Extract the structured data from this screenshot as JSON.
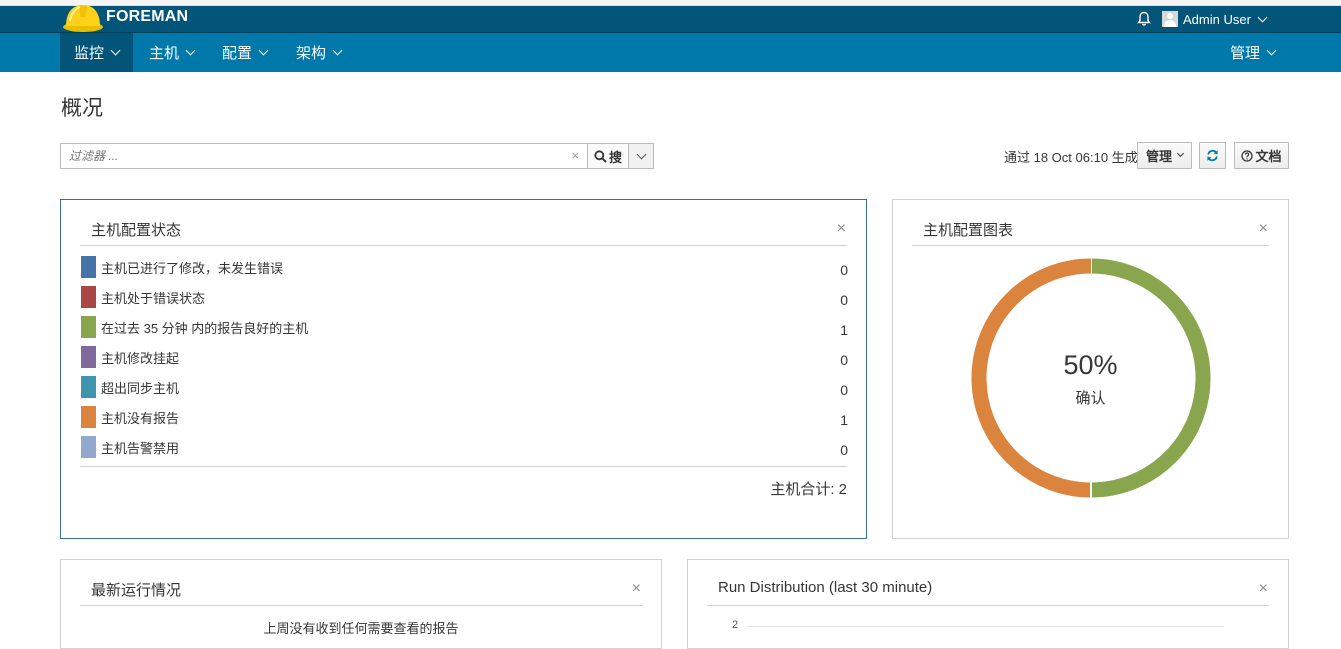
{
  "brand": {
    "name": "FOREMAN"
  },
  "header": {
    "user_name": "Admin User"
  },
  "nav": {
    "items": [
      {
        "label": "监控"
      },
      {
        "label": "主机"
      },
      {
        "label": "配置"
      },
      {
        "label": "架构"
      }
    ],
    "admin_label": "管理"
  },
  "page": {
    "title": "概况"
  },
  "search": {
    "placeholder": "过滤器 ...",
    "clear": "×",
    "button_label": "搜"
  },
  "toolbar": {
    "generated_text": "通过 18 Oct 06:10 生成",
    "manage_label": "管理",
    "docs_label": "文档"
  },
  "widgets": {
    "host_status": {
      "title": "主机配置状态",
      "close": "×",
      "rows": [
        {
          "label": "主机已进行了修改，未发生错误",
          "count": "0",
          "color": "#4572a7"
        },
        {
          "label": "主机处于错误状态",
          "count": "0",
          "color": "#aa4643"
        },
        {
          "label": "在过去 35 分钟 内的报告良好的主机",
          "count": "1",
          "color": "#89a54e"
        },
        {
          "label": "主机修改挂起",
          "count": "0",
          "color": "#80699b"
        },
        {
          "label": "超出同步主机",
          "count": "0",
          "color": "#3d96ae"
        },
        {
          "label": "主机没有报告",
          "count": "1",
          "color": "#db843d"
        },
        {
          "label": "主机告警禁用",
          "count": "0",
          "color": "#92a8cd"
        }
      ],
      "total_label": "主机合计: 2"
    },
    "host_chart": {
      "title": "主机配置图表",
      "close": "×",
      "percent": "50%",
      "caption": "确认",
      "segments": [
        {
          "value": 50,
          "color": "#89a54e"
        },
        {
          "value": 50,
          "color": "#db843d"
        }
      ]
    },
    "latest_events": {
      "title": "最新运行情况",
      "close": "×",
      "message": "上周没有收到任何需要查看的报告"
    },
    "run_distribution": {
      "title": "Run Distribution (last 30 minute)",
      "close": "×",
      "y_tick": "2"
    }
  }
}
